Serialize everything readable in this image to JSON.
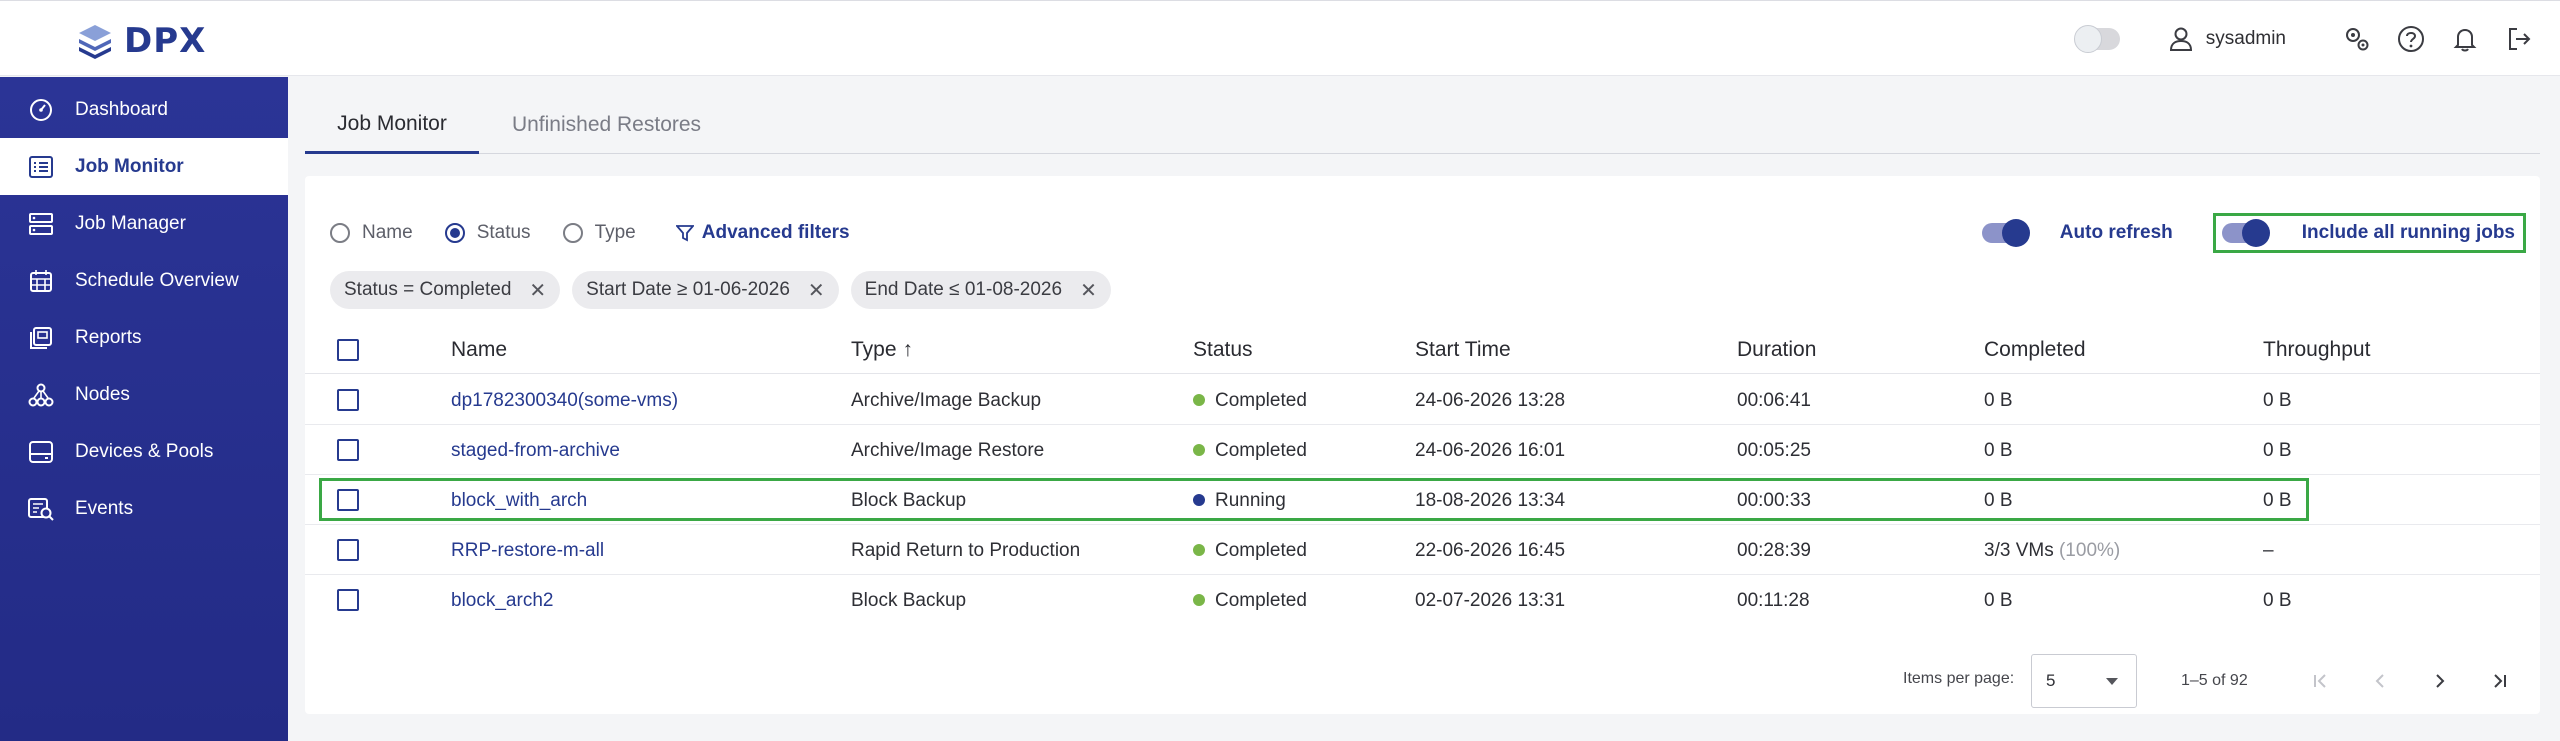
{
  "app": {
    "brand": "DPX"
  },
  "header": {
    "username": "sysadmin"
  },
  "sidebar": {
    "items": [
      {
        "label": "Dashboard",
        "icon": "gauge-icon"
      },
      {
        "label": "Job Monitor",
        "icon": "list-icon",
        "active": true
      },
      {
        "label": "Job Manager",
        "icon": "server-stack-icon"
      },
      {
        "label": "Schedule Overview",
        "icon": "calendar-icon"
      },
      {
        "label": "Reports",
        "icon": "reports-icon"
      },
      {
        "label": "Nodes",
        "icon": "nodes-icon"
      },
      {
        "label": "Devices & Pools",
        "icon": "device-icon"
      },
      {
        "label": "Events",
        "icon": "events-icon"
      }
    ]
  },
  "tabs": [
    {
      "label": "Job Monitor",
      "active": true
    },
    {
      "label": "Unfinished Restores",
      "active": false
    }
  ],
  "filters": {
    "radios": [
      {
        "label": "Name",
        "selected": false
      },
      {
        "label": "Status",
        "selected": true
      },
      {
        "label": "Type",
        "selected": false
      }
    ],
    "advanced": "Advanced filters",
    "auto_refresh": "Auto refresh",
    "include_running": "Include all running jobs",
    "chips": [
      "Status = Completed",
      "Start Date ≥ 01-06-2026",
      "End Date ≤ 01-08-2026"
    ]
  },
  "table": {
    "columns": [
      "Name",
      "Type",
      "Status",
      "Start Time",
      "Duration",
      "Completed",
      "Throughput"
    ],
    "sort_arrow": "↑",
    "rows": [
      {
        "name": "dp1782300340(some-vms)",
        "type": "Archive/Image Backup",
        "status": "Completed",
        "start": "24-06-2026 13:28",
        "duration": "00:06:41",
        "completed": "0 B",
        "completed_extra": "",
        "throughput": "0 B"
      },
      {
        "name": "staged-from-archive",
        "type": "Archive/Image Restore",
        "status": "Completed",
        "start": "24-06-2026 16:01",
        "duration": "00:05:25",
        "completed": "0 B",
        "completed_extra": "",
        "throughput": "0 B"
      },
      {
        "name": "block_with_arch",
        "type": "Block Backup",
        "status": "Running",
        "start": "18-08-2026 13:34",
        "duration": "00:00:33",
        "completed": "0 B",
        "completed_extra": "",
        "throughput": "0 B"
      },
      {
        "name": "RRP-restore-m-all",
        "type": "Rapid Return to Production",
        "status": "Completed",
        "start": "22-06-2026 16:45",
        "duration": "00:28:39",
        "completed": "3/3 VMs",
        "completed_extra": "(100%)",
        "throughput": "–"
      },
      {
        "name": "block_arch2",
        "type": "Block Backup",
        "status": "Completed",
        "start": "02-07-2026 13:31",
        "duration": "00:11:28",
        "completed": "0 B",
        "completed_extra": "",
        "throughput": "0 B"
      }
    ]
  },
  "pagination": {
    "items_per_page_label": "Items per page:",
    "items_per_page": "5",
    "range": "1–5 of 92"
  },
  "colors": {
    "brand": "#263a8f",
    "completed": "#7ab648",
    "running": "#263a8f",
    "highlight": "#3aa845"
  }
}
